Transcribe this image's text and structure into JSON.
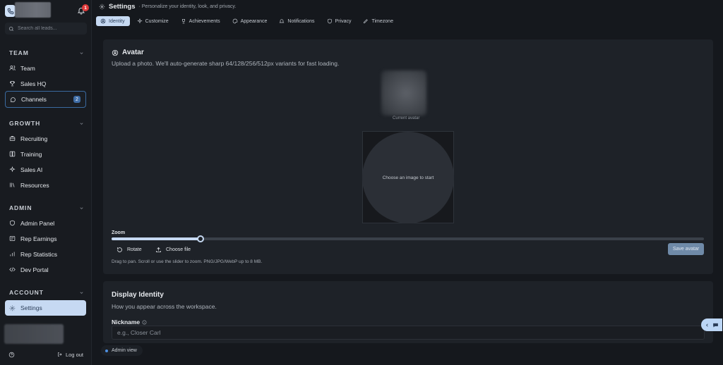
{
  "header": {
    "title": "Settings",
    "subtitle": "· Personalize your identity, look, and privacy."
  },
  "notifications": {
    "count": "1"
  },
  "search": {
    "placeholder": "Search all leads..."
  },
  "sidebar": {
    "sections": [
      {
        "title": "TEAM",
        "items": [
          {
            "label": "Team",
            "icon": "users-icon"
          },
          {
            "label": "Sales HQ",
            "icon": "trophy-icon"
          },
          {
            "label": "Channels",
            "icon": "chat-icon",
            "badge": "2"
          }
        ]
      },
      {
        "title": "GROWTH",
        "items": [
          {
            "label": "Recruiting",
            "icon": "briefcase-icon"
          },
          {
            "label": "Training",
            "icon": "book-icon"
          },
          {
            "label": "Sales AI",
            "icon": "sparkle-icon"
          },
          {
            "label": "Resources",
            "icon": "library-icon"
          }
        ]
      },
      {
        "title": "ADMIN",
        "items": [
          {
            "label": "Admin Panel",
            "icon": "shield-icon"
          },
          {
            "label": "Rep Earnings",
            "icon": "receipt-icon"
          },
          {
            "label": "Rep Statistics",
            "icon": "bar-chart-icon"
          },
          {
            "label": "Dev Portal",
            "icon": "code-icon"
          }
        ]
      },
      {
        "title": "ACCOUNT",
        "items": [
          {
            "label": "Settings",
            "icon": "gear-icon",
            "active": true
          }
        ]
      }
    ],
    "logout_label": "Log out"
  },
  "tabs": [
    {
      "label": "Identity",
      "icon": "user-circle-icon",
      "active": true
    },
    {
      "label": "Customize",
      "icon": "sparkle-icon"
    },
    {
      "label": "Achievements",
      "icon": "trophy-icon"
    },
    {
      "label": "Appearance",
      "icon": "palette-icon"
    },
    {
      "label": "Notifications",
      "icon": "bell-icon"
    },
    {
      "label": "Privacy",
      "icon": "shield-icon"
    },
    {
      "label": "Timezone",
      "icon": "pen-icon"
    }
  ],
  "avatar": {
    "title": "Avatar",
    "subtitle": "Upload a photo. We'll auto-generate sharp 64/128/256/512px variants for fast loading.",
    "current_label": "Current avatar",
    "crop_placeholder": "Choose an image to start",
    "zoom_label": "Zoom",
    "zoom_level": 0.15,
    "rotate_label": "Rotate",
    "choose_file_label": "Choose file",
    "save_label": "Save avatar",
    "help": "Drag to pan. Scroll or use the slider to zoom. PNG/JPG/WebP up to 8 MB."
  },
  "identity": {
    "title": "Display Identity",
    "subtitle": "How you appear across the workspace.",
    "nickname_label": "Nickname",
    "nickname_placeholder": "e.g., Closer Carl",
    "nickname_value": ""
  },
  "admin_view_label": "Admin view",
  "colors": {
    "accent": "#c6d9f2",
    "background": "#15181d",
    "card": "#1e2228",
    "badge_red": "#e03a3a"
  }
}
